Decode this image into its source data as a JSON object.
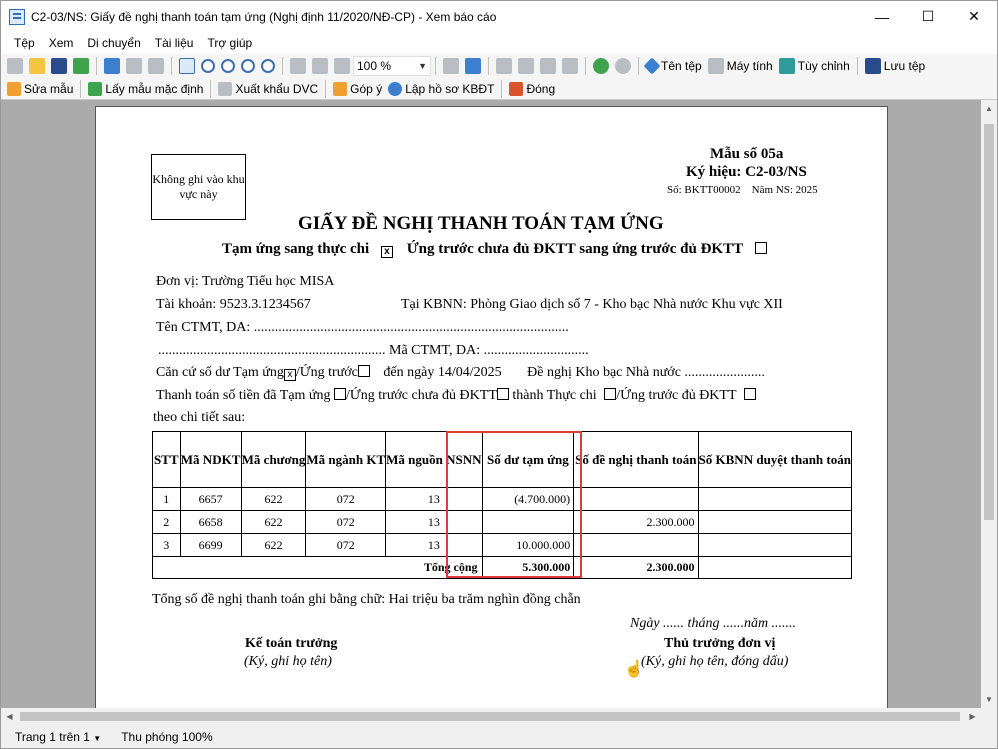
{
  "window": {
    "title": "C2-03/NS: Giấy đề nghị thanh toán tạm ứng (Nghị định 11/2020/NĐ-CP) - Xem báo cáo",
    "minimize": "—",
    "maximize": "☐",
    "close": "✕"
  },
  "menu": [
    "Tệp",
    "Xem",
    "Di chuyển",
    "Tài liệu",
    "Trợ giúp"
  ],
  "toolbar1": {
    "zoom": "100 %",
    "file_name": "Tên tệp",
    "calculator": "Máy tính",
    "customize": "Tùy chỉnh",
    "save_file": "Lưu tệp"
  },
  "toolbar2": {
    "edit_template": "Sửa mẫu",
    "default_template": "Lấy mẫu mặc định",
    "export_dvc": "Xuất khẩu DVC",
    "feedback": "Góp ý",
    "kbdt_file": "Lập hồ sơ KBĐT",
    "close": "Đóng"
  },
  "status": {
    "page": "Trang 1 trên 1",
    "zoom": "Thu phóng 100%"
  },
  "document": {
    "stamp": "Không ghi vào khu vực này",
    "form_no": "Mẫu số 05a",
    "symbol": "Ký hiệu: C2-03/NS",
    "number_year": "Số: BKTT00002    Năm NS: 2025",
    "title": "GIẤY ĐỀ NGHỊ THANH TOÁN TẠM ỨNG",
    "sub_left": "Tạm ứng sang thực chi",
    "sub_left_mark": "x",
    "sub_right": "Ứng trước chưa đủ ĐKTT sang ứng trước đủ ĐKTT",
    "unit": "Đơn vị: Trường Tiểu học MISA",
    "account": "Tài khoản: 9523.3.1234567",
    "kbnn": "Tại KBNN: Phòng Giao dịch số 7 - Kho bạc Nhà nước Khu vực XII",
    "ctmt_name": "Tên CTMT, DA:  ..........................................................................................",
    "ctmt_code": "................................................................. Mã CTMT, DA: ..............................",
    "line1_a": "Căn cứ số dư Tạm ứng",
    "line1_mark": "x",
    "line1_b": "/Ứng trước",
    "line1_c": "đến ngày 14/04/2025",
    "line1_d": "Đề nghị Kho bạc Nhà nước .......................",
    "line2_a": "Thanh toán số tiền đã Tạm ứng",
    "line2_b": "/Ứng trước chưa đủ ĐKTT",
    "line2_c": "thành Thực chi",
    "line2_d": "/Ứng trước đủ ĐKTT",
    "line3": "theo chi tiết sau:",
    "total_words": "Tổng số đề nghị thanh toán ghi bằng chữ: Hai triệu ba trăm nghìn đồng chẵn",
    "date_line": "Ngày ...... tháng ......năm .......",
    "sign_left_title": "Kế toán trưởng",
    "sign_left_note": "(Ký, ghi họ tên)",
    "sign_right_title": "Thủ trưởng đơn vị",
    "sign_right_note": "(Ký, ghi họ tên, đóng dấu)"
  },
  "table": {
    "headers": [
      "STT",
      "Mã NDKT",
      "Mã chương",
      "Mã ngành KT",
      "Mã nguồn NSNN",
      "Số dư tạm ứng",
      "Số đề nghị thanh toán",
      "Số KBNN duyệt thanh toán"
    ],
    "rows": [
      [
        "1",
        "6657",
        "622",
        "072",
        "13",
        "(4.700.000)",
        "",
        ""
      ],
      [
        "2",
        "6658",
        "622",
        "072",
        "13",
        "",
        "2.300.000",
        ""
      ],
      [
        "3",
        "6699",
        "622",
        "072",
        "13",
        "10.000.000",
        "",
        ""
      ]
    ],
    "total_label": "Tổng cộng",
    "total_balance": "5.300.000",
    "total_request": "2.300.000",
    "total_approved": ""
  }
}
